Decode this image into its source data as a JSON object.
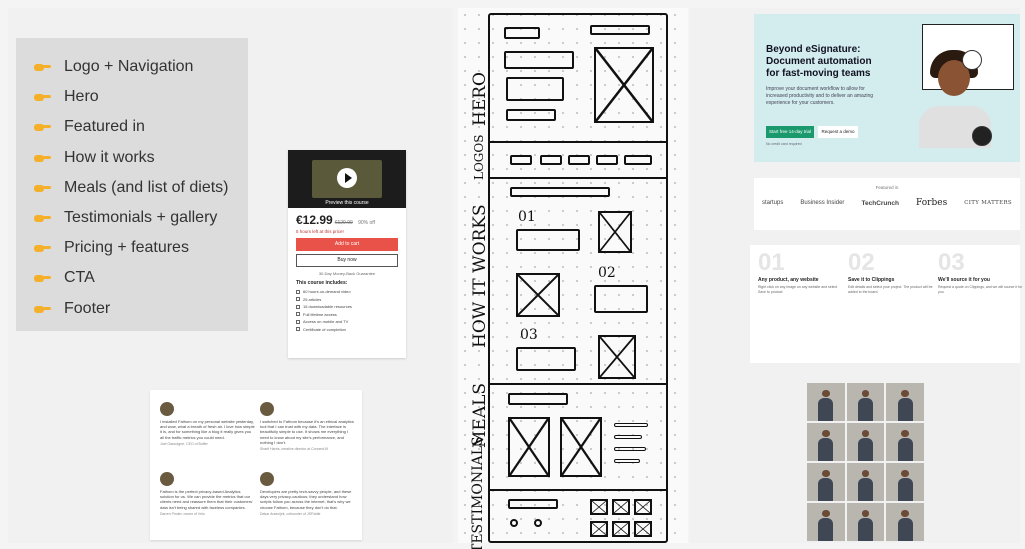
{
  "sections": {
    "items": [
      "Logo + Navigation",
      "Hero",
      "Featured in",
      "How it works",
      "Meals (and list of diets)",
      "Testimonials + gallery",
      "Pricing + features",
      "CTA",
      "Footer"
    ]
  },
  "course": {
    "preview": "Preview this course",
    "price": "€12.99",
    "old_price": "€129.99",
    "discount": "90% off",
    "hours_left": "5 hours left at this price!",
    "add_to_cart": "Add to cart",
    "buy_now": "Buy now",
    "guarantee": "30-Day Money-Back Guarantee",
    "includes_title": "This course includes:",
    "features": [
      "60 hours on-demand video",
      "25 articles",
      "15 downloadable resources",
      "Full lifetime access",
      "Access on mobile and TV",
      "Certificate of completion"
    ]
  },
  "testimonials": [
    {
      "text": "I installed Fathom on my personal website yesterday, and wow, what a breath of fresh air. I love how simple it is, and for something like a blog it really gives you all the traffic metrics you could need.",
      "author": "Joel Gascoigne, CEO of Buffer"
    },
    {
      "text": "I switched to Fathom because it's an ethical analytics tool that I can trust with my data. The interface is beautifully simple to use. It shows me everything I need to know about my site's performance, and nothing I don't.",
      "author": "Sharif Harris, creative director at Connect19"
    },
    {
      "text": "Fathom is the perfect privacy-based Analytics solution for us. We can provide the metrics that our clients need and reassure them that their customers' data isn't being shared with faceless companies.",
      "author": "Darren Pinder, owner of Velo"
    },
    {
      "text": "Developers are pretty tech-savvy people, and these days very privacy-cautious; they understand how scripts follow you across the internet, that's why we choose Fathom, because they don't do that.",
      "author": "Dakar Arsenijek, cofounder of JSFiddle"
    }
  ],
  "wireframe": {
    "labels": [
      "HERO",
      "LOGOS",
      "HOW IT WORKS",
      "MEALS",
      "TESTIMONIALS"
    ],
    "step_numbers": [
      "01",
      "02",
      "03"
    ]
  },
  "esign": {
    "headline": "Beyond eSignature: Document automation for fast-moving teams",
    "subtext": "Improve your document workflow to allow for increased productivity and to deliver an amazing experience for your customers.",
    "primary": "Start free 14-day trial",
    "secondary": "Request a demo",
    "note": "No credit card required"
  },
  "featured": {
    "label": "Featured in",
    "logos": [
      "startups",
      "Business Insider",
      "TechCrunch",
      "Forbes",
      "CITY MATTERS"
    ]
  },
  "steps": [
    {
      "n": "01",
      "title": "Any product, any website",
      "desc": "Right click on any image on any website and select Save to product"
    },
    {
      "n": "02",
      "title": "Save it to Clippings",
      "desc": "Edit details and select your project. The product will be added to the board."
    },
    {
      "n": "03",
      "title": "We'll source it for you",
      "desc": "Request a quote on Clippings, and we will source it for you"
    }
  ],
  "colors": {
    "accent_green": "#1a9a6c",
    "hero_bg": "#d3ecee",
    "cart_red": "#e85248",
    "section_bg": "#dcdcdc"
  }
}
